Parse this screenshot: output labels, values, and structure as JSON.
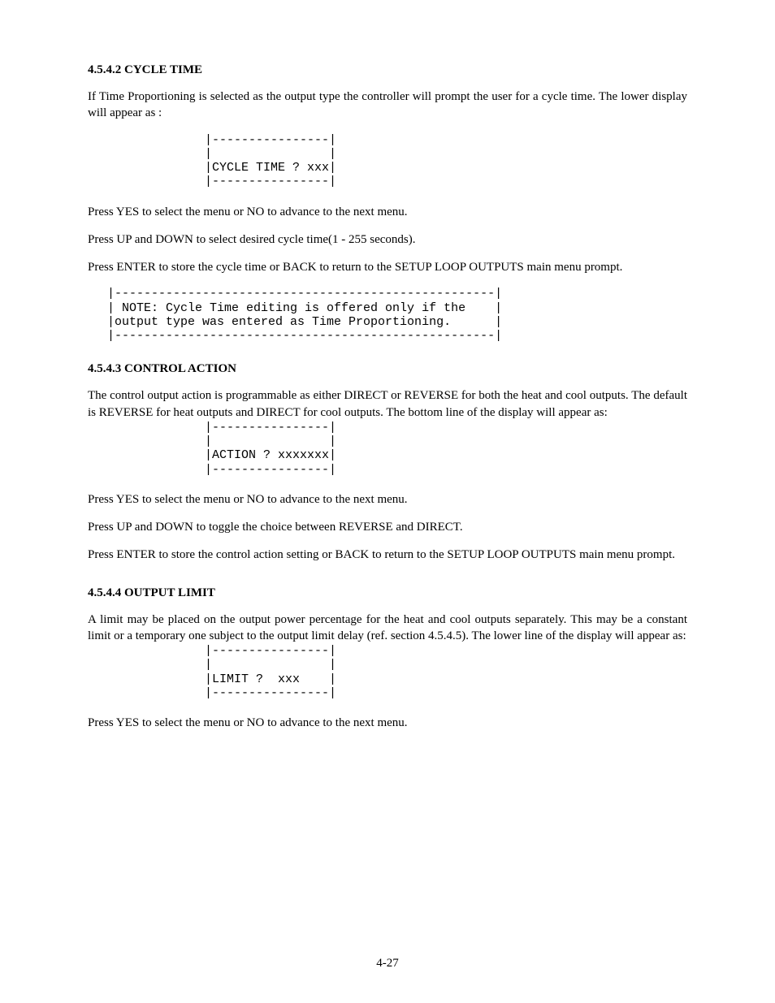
{
  "section1": {
    "heading": "4.5.4.2 CYCLE TIME",
    "p1": "If Time Proportioning is selected as the output type the controller will prompt the user for a cycle time. The lower display will appear as :",
    "display": "|----------------|\n|                |\n|CYCLE TIME ? xxx|\n|----------------|",
    "p2": "Press YES to select the menu or NO to advance to the next menu.",
    "p3": "Press UP and DOWN to select desired cycle time(1 - 255 seconds).",
    "p4": "Press ENTER to store the cycle time  or BACK to return to the SETUP LOOP OUTPUTS main menu prompt.",
    "note": "|----------------------------------------------------|\n| NOTE: Cycle Time editing is offered only if the    |\n|output type was entered as Time Proportioning.      |\n|----------------------------------------------------|"
  },
  "section2": {
    "heading": "4.5.4.3 CONTROL ACTION",
    "p1": "The control output action is programmable as either DIRECT or REVERSE for both the heat and cool outputs. The default is REVERSE for heat outputs and DIRECT for cool outputs. The bottom line of the display will appear as:",
    "display": "|----------------|\n|                |\n|ACTION ? xxxxxxx|\n|----------------|",
    "p2": "Press YES to select the menu or NO to advance to the next menu.",
    "p3": "Press UP and DOWN to toggle the choice between REVERSE and DIRECT.",
    "p4": "Press ENTER to store the control action setting  or BACK to return to the SETUP LOOP OUTPUTS main menu prompt."
  },
  "section3": {
    "heading": "4.5.4.4 OUTPUT LIMIT",
    "p1": "A limit may be placed on the output power percentage for the heat and cool outputs separately. This may be a constant limit or a temporary one subject to the output limit delay (ref. section 4.5.4.5). The lower line of the display will appear as:",
    "display": "|----------------|\n|                |\n|LIMIT ?  xxx    |\n|----------------|",
    "p2": "Press YES to select the menu or NO to advance to the next menu."
  },
  "page_number": "4-27"
}
